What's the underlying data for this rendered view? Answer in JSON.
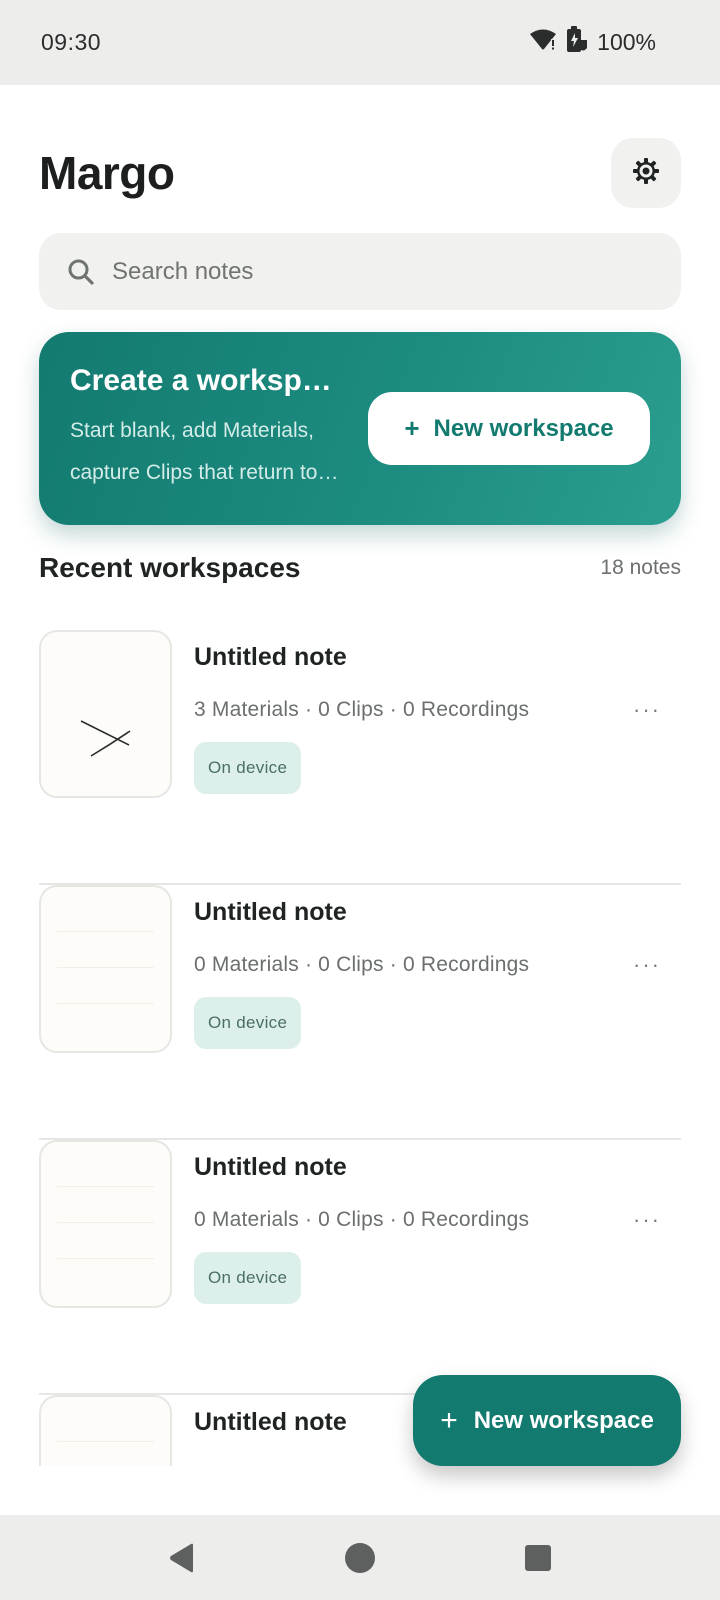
{
  "status_bar": {
    "time": "09:30",
    "battery": "100%",
    "icons": [
      "wifi-icon",
      "battery-icon"
    ]
  },
  "header": {
    "title": "Margo",
    "settings_icon": "gear-icon"
  },
  "search": {
    "placeholder": "Search notes",
    "value": ""
  },
  "promo": {
    "title": "Create a workspace",
    "text": "Start blank, add Materials, capture Clips that return to source",
    "button_plus": "+",
    "button_label": "New workspace"
  },
  "recent": {
    "title": "Recent workspaces",
    "count": "18 notes"
  },
  "notes": [
    {
      "title": "Untitled note",
      "meta": "3 Materials · 0 Clips · 0 Recordings",
      "badge": "On device",
      "more": "···"
    },
    {
      "title": "Untitled note",
      "meta": "0 Materials · 0 Clips · 0 Recordings",
      "badge": "On device",
      "more": "···"
    },
    {
      "title": "Untitled note",
      "meta": "0 Materials · 0 Clips · 0 Recordings",
      "badge": "On device",
      "more": "···"
    },
    {
      "title": "Untitled note"
    }
  ],
  "fab": {
    "plus": "+",
    "label": "New workspace"
  },
  "colors": {
    "accent": "#137a70",
    "badge_bg": "#dcefea",
    "surface": "#f1f2ef"
  }
}
